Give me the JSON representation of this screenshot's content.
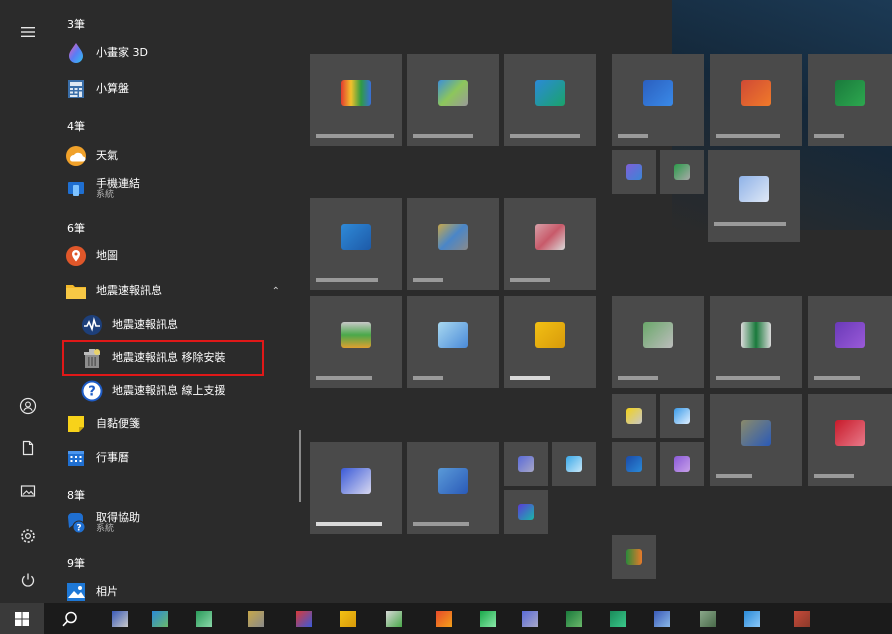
{
  "app_list": {
    "groups": [
      {
        "header": "3筆",
        "items": [
          {
            "name": "小畫家 3D",
            "icon": "paint3d-icon"
          },
          {
            "name": "小算盤",
            "icon": "calculator-icon"
          }
        ]
      },
      {
        "header": "4筆",
        "items": [
          {
            "name": "天氣",
            "icon": "weather-icon"
          },
          {
            "name": "手機連結",
            "sub": "系統",
            "icon": "phone-link-icon"
          }
        ]
      },
      {
        "header": "6筆",
        "items": [
          {
            "name": "地圖",
            "icon": "maps-icon"
          },
          {
            "name": "地震速報訊息",
            "icon": "folder-icon",
            "expanded": true,
            "chevron": "⌃"
          },
          {
            "name": "地震速報訊息",
            "icon": "earthquake-app-icon"
          },
          {
            "name": "地震速報訊息 移除安裝",
            "icon": "uninstall-icon",
            "highlighted": true
          },
          {
            "name": "地震速報訊息 線上支援",
            "icon": "help-icon"
          },
          {
            "name": "自黏便箋",
            "icon": "sticky-notes-icon"
          },
          {
            "name": "行事曆",
            "icon": "calendar-icon"
          }
        ]
      },
      {
        "header": "8筆",
        "items": [
          {
            "name": "取得協助",
            "sub": "系統",
            "icon": "get-help-icon"
          }
        ]
      },
      {
        "header": "9筆",
        "items": [
          {
            "name": "相片",
            "icon": "photos-icon"
          }
        ]
      }
    ]
  },
  "rail": {
    "items": [
      {
        "name": "hamburger-menu-icon"
      },
      {
        "name": "user-account-icon"
      },
      {
        "name": "documents-icon"
      },
      {
        "name": "pictures-icon"
      },
      {
        "name": "settings-icon"
      },
      {
        "name": "power-icon"
      }
    ]
  },
  "colors": {
    "menu_bg": "#2b2b2b",
    "tile_bg": "#4a4a4a",
    "highlight": "#e01818",
    "taskbar_bg": "#1b1b1b"
  }
}
